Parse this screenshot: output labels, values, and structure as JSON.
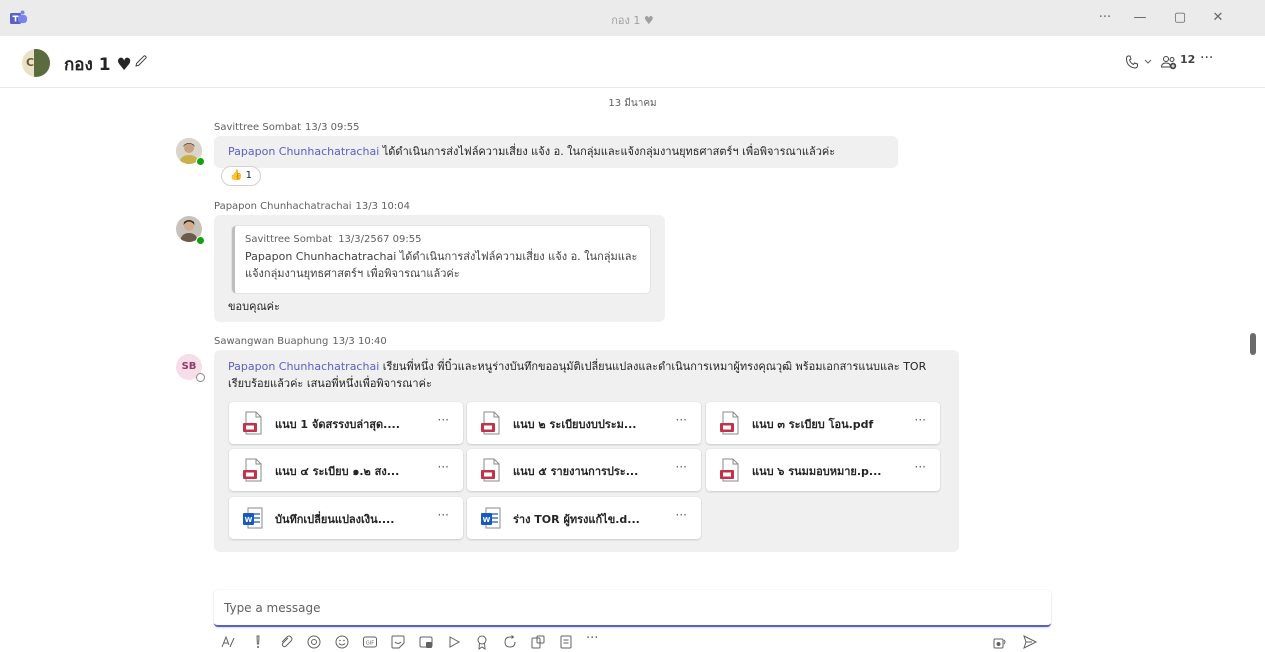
{
  "window": {
    "title": "กอง 1 ♥",
    "controls": {
      "more": "···",
      "minimize": "—",
      "restore": "▢",
      "close": "✕"
    }
  },
  "header": {
    "avatar_letter": "C",
    "chat_title": "กอง 1 ♥",
    "participants_count": "12",
    "more": "···"
  },
  "messages": {
    "date_separator": "13 มีนาคม",
    "list": [
      {
        "sender": "Savittree Sombat",
        "time": "13/3 09:55",
        "mention": "Papapon Chunhachatrachai",
        "text": " ได้ดำเนินการส่งไฟล์ความเสี่ยง แจ้ง อ. ในกลุ่มและแจ้งกลุ่มงานยุทธศาสตร์ฯ เพื่อพิจารณาแล้วค่ะ",
        "reaction": {
          "emoji": "👍",
          "count": "1"
        }
      },
      {
        "sender": "Papapon Chunhachatrachai",
        "time": "13/3 10:04",
        "quote": {
          "sender": "Savittree Sombat",
          "time": "13/3/2567 09:55",
          "text": "Papapon Chunhachatrachai ได้ดำเนินการส่งไฟล์ความเสี่ยง แจ้ง อ. ในกลุ่มและแจ้งกลุ่มงานยุทธศาสตร์ฯ เพื่อพิจารณาแล้วค่ะ"
        },
        "text": "ขอบคุณค่ะ"
      },
      {
        "sender": "Sawangwan Buaphung",
        "time": "13/3 10:40",
        "avatar_initials": "SB",
        "mention": "Papapon Chunhachatrachai",
        "text": " เรียนพี่หนึ่ง พี่บิ๋วและหนูร่างบันทึกขออนุมัติเปลี่ยนแปลงและดำเนินการเหมาผู้ทรงคุณวุฒิ พร้อมเอกสารแนบและ TOR เรียบร้อยแล้วค่ะ เสนอพี่หนึ่งเพื่อพิจารณาค่ะ",
        "attachments": [
          {
            "name": "แนบ 1 จัดสรรงบล่าสุด....",
            "type": "pdf"
          },
          {
            "name": "แนบ ๒ ระเบียบงบประม...",
            "type": "pdf"
          },
          {
            "name": "แนบ ๓ ระเบียบ โอน.pdf",
            "type": "pdf"
          },
          {
            "name": "แนบ ๔ ระเบียบ ๑.๒ สง...",
            "type": "pdf"
          },
          {
            "name": "แนบ ๕ รายงานการประ...",
            "type": "pdf"
          },
          {
            "name": "แนบ ๖ รนมมอบหมาย.p...",
            "type": "pdf"
          },
          {
            "name": "บันทึกเปลี่ยนแปลงเงิน....",
            "type": "word"
          },
          {
            "name": "ร่าง TOR ผู้ทรงแก้ไข.d...",
            "type": "word"
          }
        ],
        "attachment_more": "···"
      }
    ]
  },
  "compose": {
    "placeholder": "Type a message",
    "toolbar_more": "···"
  },
  "colors": {
    "accent": "#5b5fc7",
    "bubble": "#f0f0f0",
    "pdf": "#c4314b",
    "word": "#185abd",
    "online": "#13a10e"
  }
}
